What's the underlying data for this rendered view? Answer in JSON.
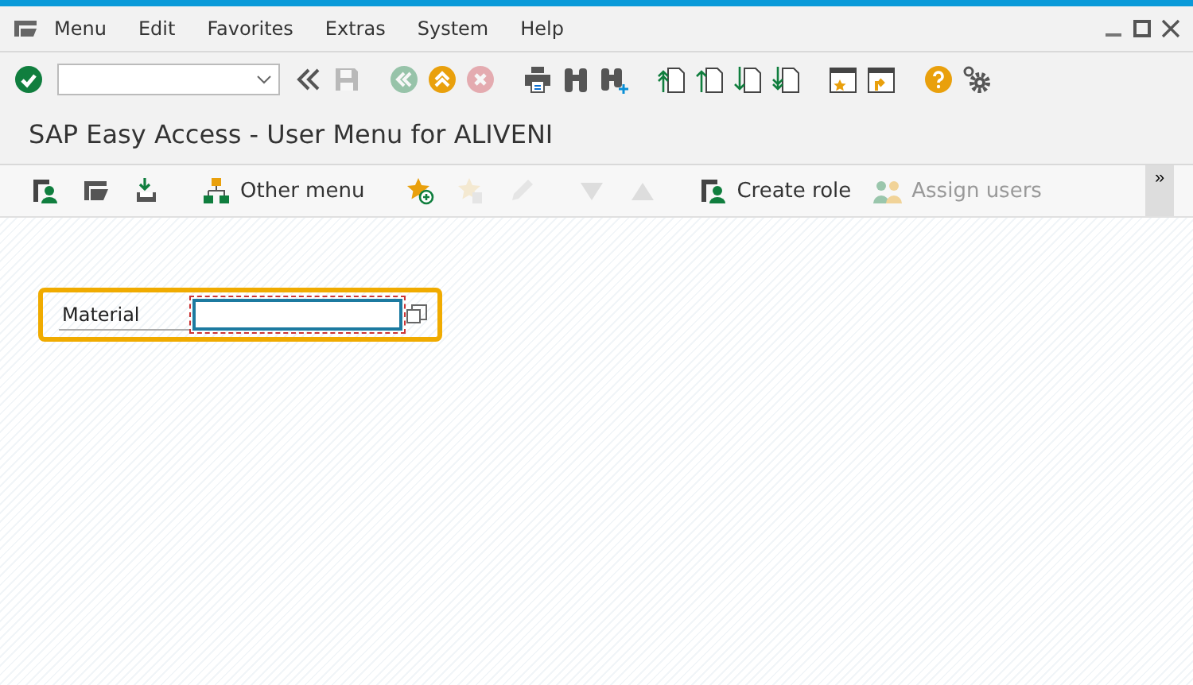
{
  "menu_bar": {
    "items": [
      {
        "label": "Menu"
      },
      {
        "label": "Edit"
      },
      {
        "label": "Favorites"
      },
      {
        "label": "Extras"
      },
      {
        "label": "System"
      },
      {
        "label": "Help"
      }
    ]
  },
  "system_toolbar": [
    {
      "kind": "enter",
      "disabled": false
    },
    {
      "kind": "collapse",
      "disabled": false
    },
    {
      "kind": "save",
      "disabled": true
    },
    {
      "kind": "back",
      "disabled": true
    },
    {
      "kind": "exit",
      "disabled": false
    },
    {
      "kind": "cancel",
      "disabled": true
    },
    {
      "kind": "print",
      "disabled": false
    },
    {
      "kind": "find",
      "disabled": false
    },
    {
      "kind": "find_next",
      "disabled": false
    },
    {
      "kind": "first_page",
      "disabled": false
    },
    {
      "kind": "prev_page",
      "disabled": false
    },
    {
      "kind": "next_page",
      "disabled": false
    },
    {
      "kind": "last_page",
      "disabled": false
    },
    {
      "kind": "new_session",
      "disabled": false
    },
    {
      "kind": "shortcut",
      "disabled": false
    },
    {
      "kind": "help",
      "disabled": false
    },
    {
      "kind": "settings",
      "disabled": false
    }
  ],
  "title": "SAP Easy Access  -  User Menu for ALIVENI",
  "app_toolbar": [
    {
      "kind": "user_menu",
      "disabled": false
    },
    {
      "kind": "sap_menu",
      "disabled": false
    },
    {
      "kind": "download",
      "disabled": false
    },
    {
      "kind": "other_menu",
      "label": "Other menu",
      "disabled": false
    },
    {
      "kind": "add_favorite",
      "disabled": false
    },
    {
      "kind": "delete_favorite",
      "disabled": true
    },
    {
      "kind": "edit",
      "disabled": true
    },
    {
      "kind": "move_down",
      "disabled": true
    },
    {
      "kind": "move_up",
      "disabled": true
    },
    {
      "kind": "create_role",
      "label": "Create role",
      "disabled": false
    },
    {
      "kind": "assign_users",
      "label": "Assign users",
      "disabled": true
    }
  ],
  "overflow": "»",
  "field": {
    "label": "Material",
    "highlighted": true
  }
}
